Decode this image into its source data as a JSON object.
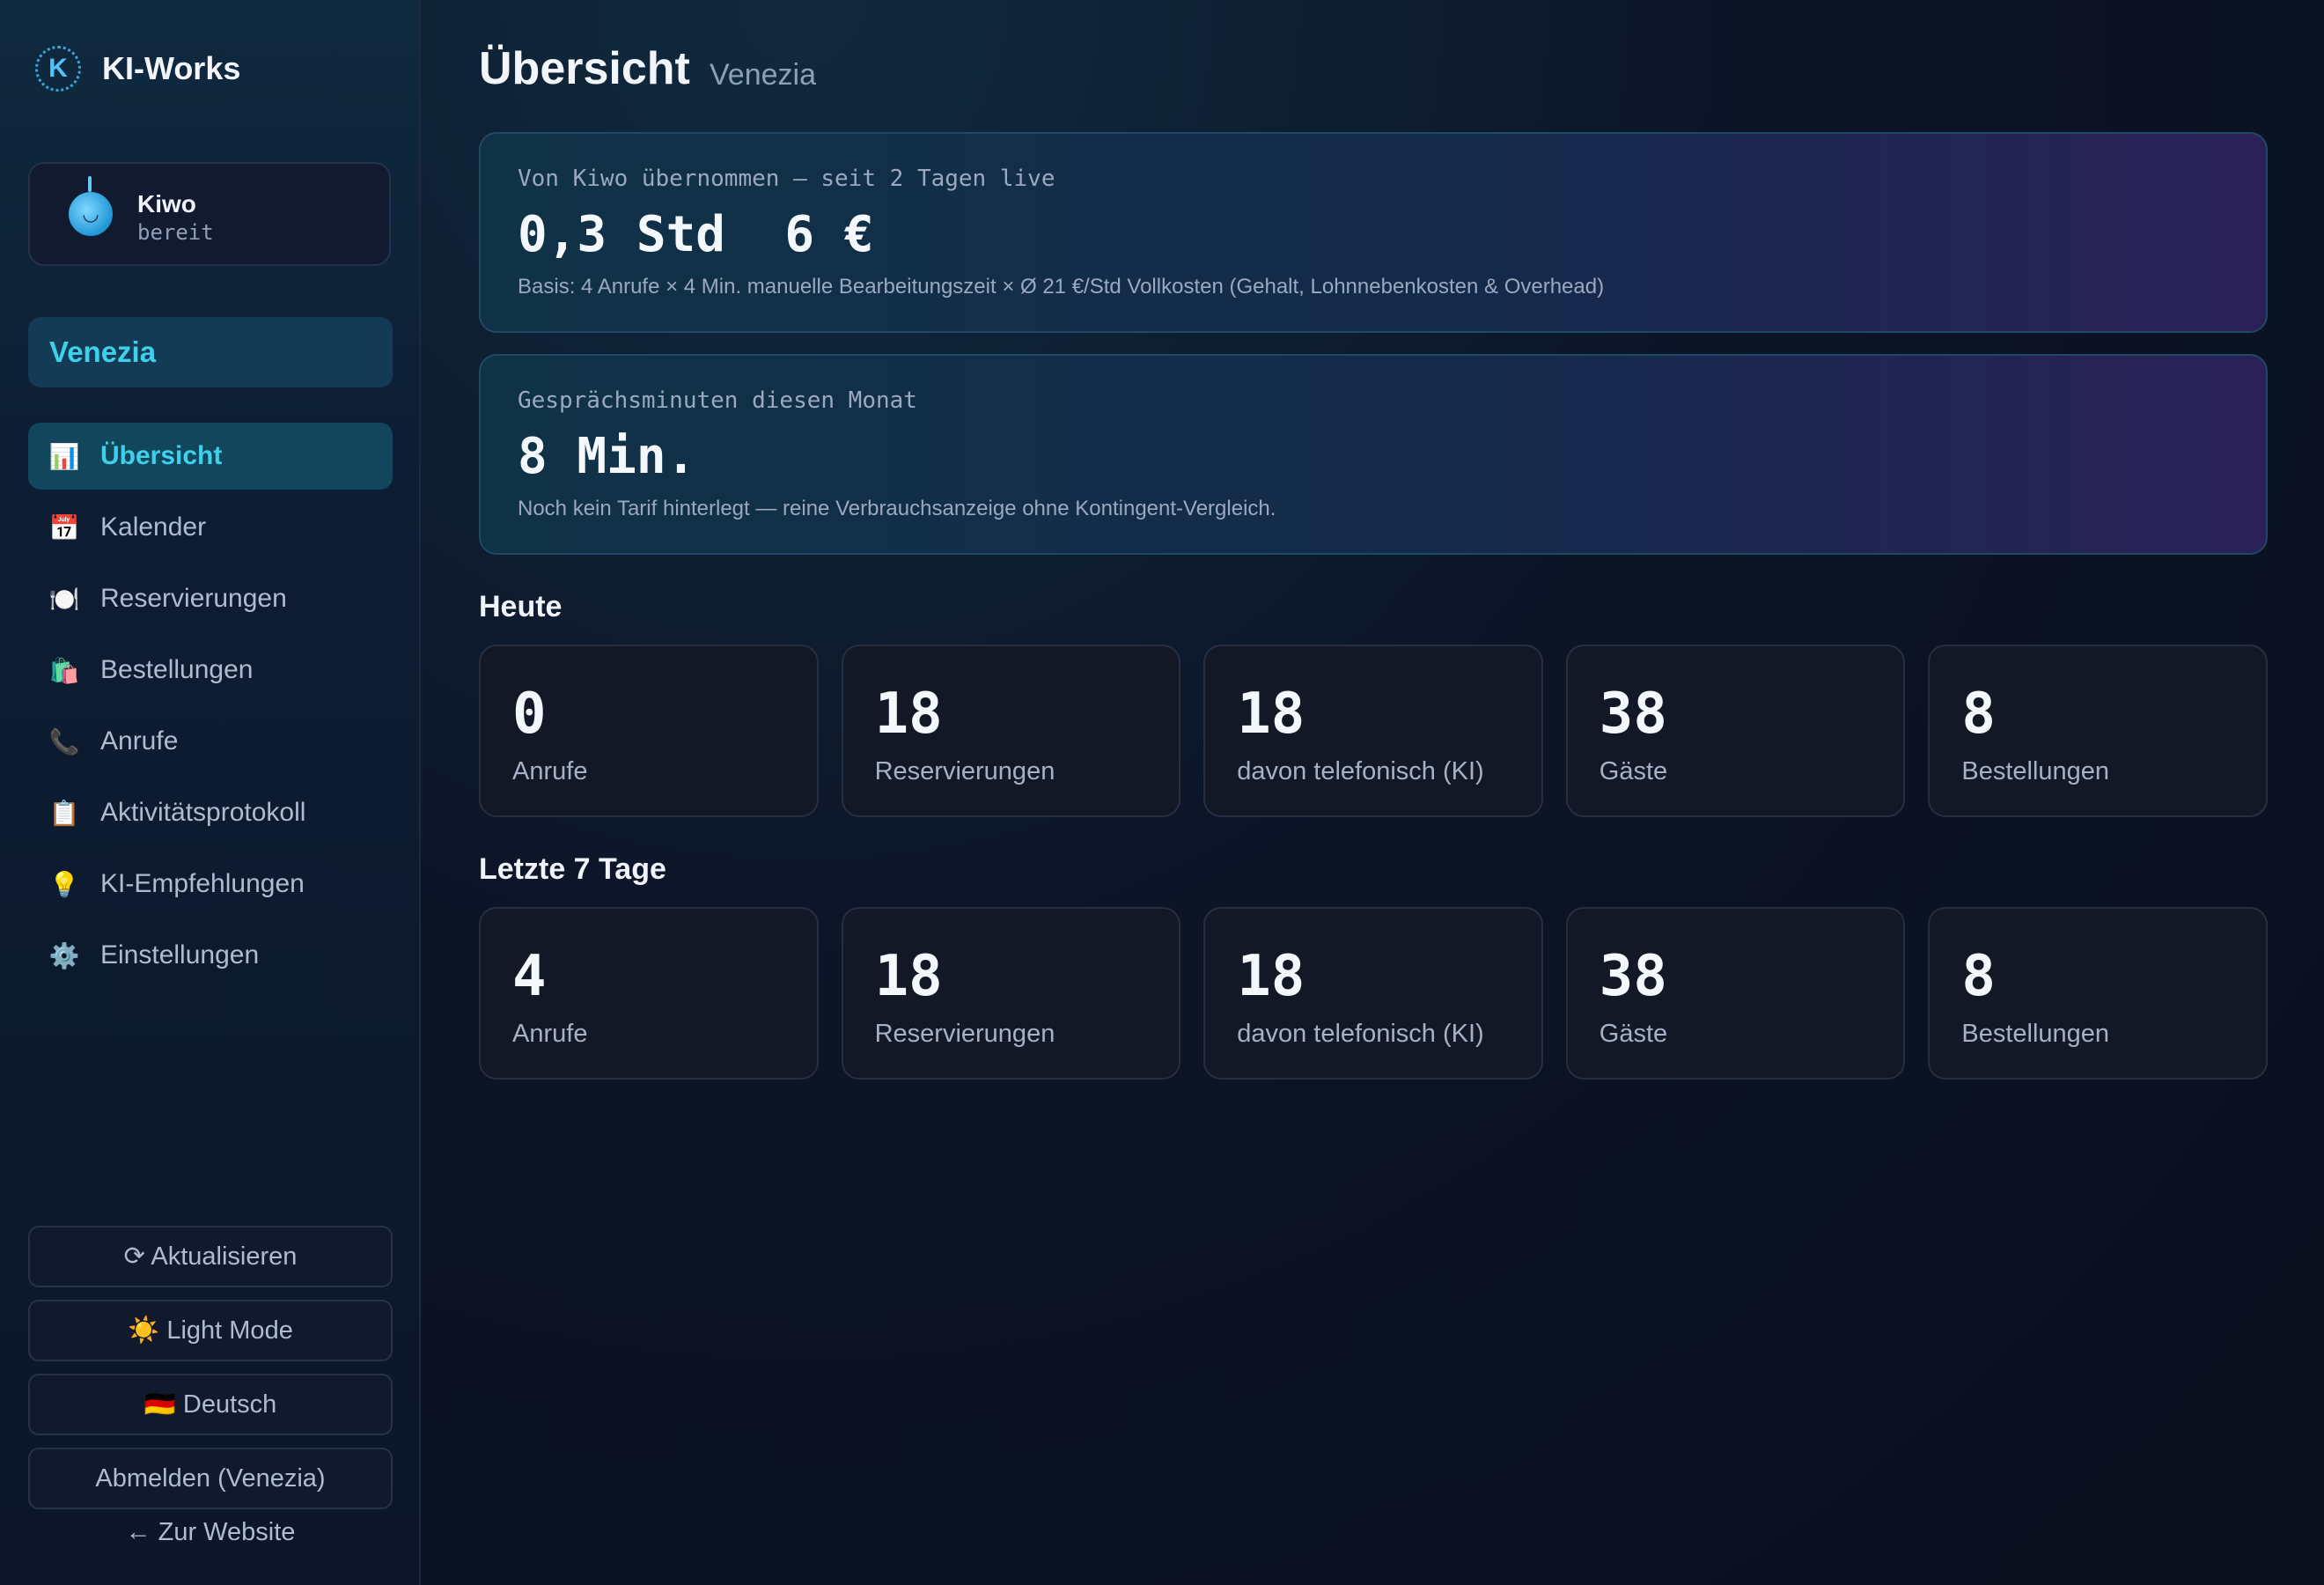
{
  "app": {
    "brand_name": "KI-Works",
    "logo_letter": "K"
  },
  "assistant": {
    "name": "Kiwo",
    "status": "bereit",
    "avatar_glyph": "◡"
  },
  "tenant": {
    "name": "Venezia"
  },
  "nav": {
    "items": [
      {
        "icon": "📊",
        "icon_name": "chart-icon",
        "label": "Übersicht",
        "active": true
      },
      {
        "icon": "📅",
        "icon_name": "calendar-icon",
        "label": "Kalender"
      },
      {
        "icon": "🍽️",
        "icon_name": "plate-icon",
        "label": "Reservierungen"
      },
      {
        "icon": "🛍️",
        "icon_name": "shopping-bag-icon",
        "label": "Bestellungen"
      },
      {
        "icon": "📞",
        "icon_name": "phone-icon",
        "label": "Anrufe"
      },
      {
        "icon": "📋",
        "icon_name": "clipboard-icon",
        "label": "Aktivitätsprotokoll"
      },
      {
        "icon": "💡",
        "icon_name": "lightbulb-icon",
        "label": "KI-Empfehlungen"
      },
      {
        "icon": "⚙️",
        "icon_name": "gear-icon",
        "label": "Einstellungen"
      }
    ]
  },
  "sidebar_actions": {
    "refresh": "⟳ Aktualisieren",
    "theme": "☀️ Light Mode",
    "language": "🇩🇪 Deutsch",
    "logout": "Abmelden (Venezia)",
    "back": "← Zur Website"
  },
  "header": {
    "title": "Übersicht",
    "subtitle": "Venezia"
  },
  "savings": {
    "label": "Von Kiwo übernommen — seit 2 Tagen live",
    "value": "0,3 Std  6 €",
    "note": "Basis: 4 Anrufe × 4 Min. manuelle Bearbeitungszeit × Ø 21 €/Std Vollkosten (Gehalt, Lohnnebenkosten & Overhead)"
  },
  "minutes": {
    "label": "Gesprächsminuten diesen Monat",
    "value": "8 Min.",
    "note": "Noch kein Tarif hinterlegt — reine Verbrauchsanzeige ohne Kontingent-Vergleich."
  },
  "today": {
    "heading": "Heute",
    "stats": [
      {
        "value": "0",
        "label": "Anrufe"
      },
      {
        "value": "18",
        "label": "Reservierungen"
      },
      {
        "value": "18",
        "label": "davon telefonisch (KI)"
      },
      {
        "value": "38",
        "label": "Gäste"
      },
      {
        "value": "8",
        "label": "Bestellungen"
      }
    ]
  },
  "week": {
    "heading": "Letzte 7 Tage",
    "stats": [
      {
        "value": "4",
        "label": "Anrufe"
      },
      {
        "value": "18",
        "label": "Reservierungen"
      },
      {
        "value": "18",
        "label": "davon telefonisch (KI)"
      },
      {
        "value": "38",
        "label": "Gäste"
      },
      {
        "value": "8",
        "label": "Bestellungen"
      }
    ]
  }
}
